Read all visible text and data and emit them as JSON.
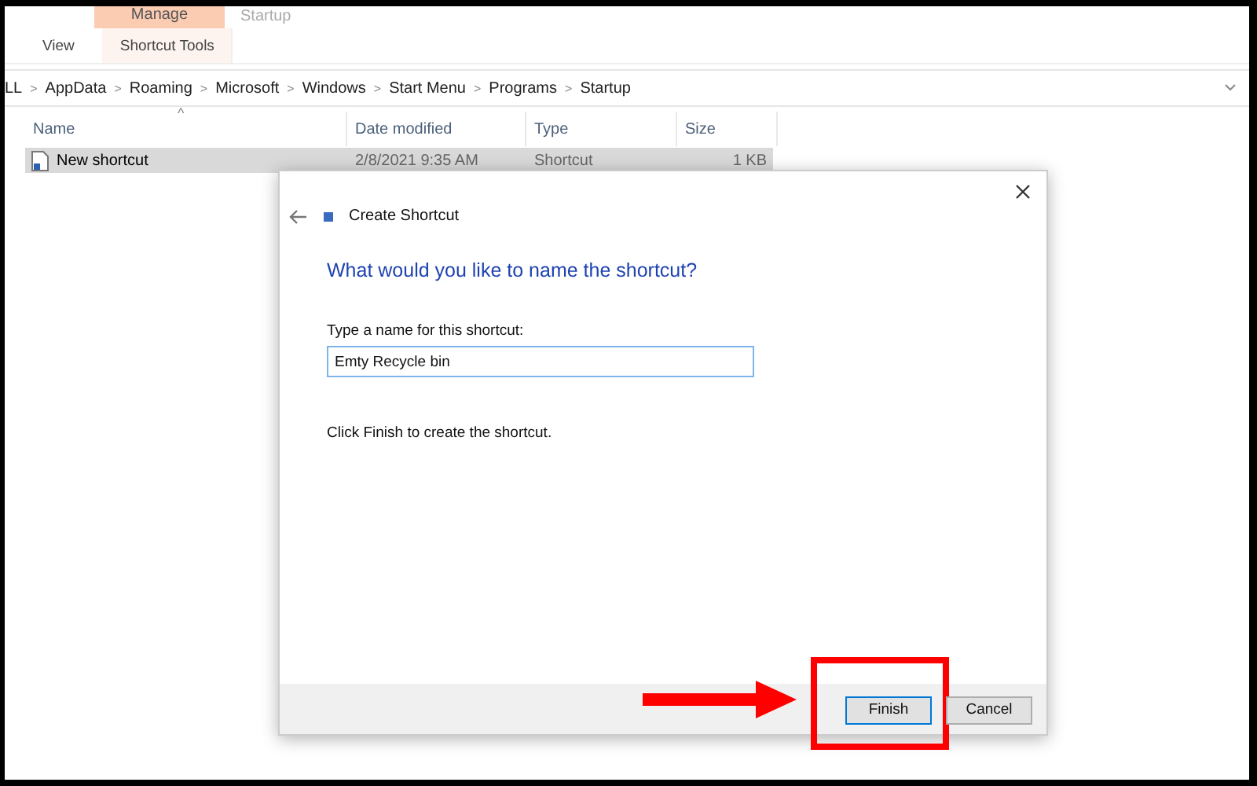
{
  "ribbon": {
    "context_group": "Manage",
    "window_title": "Startup",
    "tabs": [
      {
        "label": "View",
        "selected": false
      },
      {
        "label": "Shortcut Tools",
        "selected": true
      }
    ]
  },
  "address_bar": {
    "crumbs": [
      "LL",
      "AppData",
      "Roaming",
      "Microsoft",
      "Windows",
      "Start Menu",
      "Programs",
      "Startup"
    ],
    "separator": ">"
  },
  "table": {
    "sort_indicator": "^",
    "columns": [
      "Name",
      "Date modified",
      "Type",
      "Size"
    ],
    "rows": [
      {
        "name": "New shortcut",
        "date_modified": "2/8/2021 9:35 AM",
        "type": "Shortcut",
        "size": "1 KB",
        "selected": true
      }
    ]
  },
  "dialog": {
    "title": "Create Shortcut",
    "heading": "What would you like to name the shortcut?",
    "field_label": "Type a name for this shortcut:",
    "field_value": "Emty Recycle bin",
    "hint": "Click Finish to create the shortcut.",
    "buttons": [
      {
        "label": "Finish",
        "default": true,
        "highlighted": true
      },
      {
        "label": "Cancel",
        "default": false,
        "highlighted": false
      }
    ]
  }
}
